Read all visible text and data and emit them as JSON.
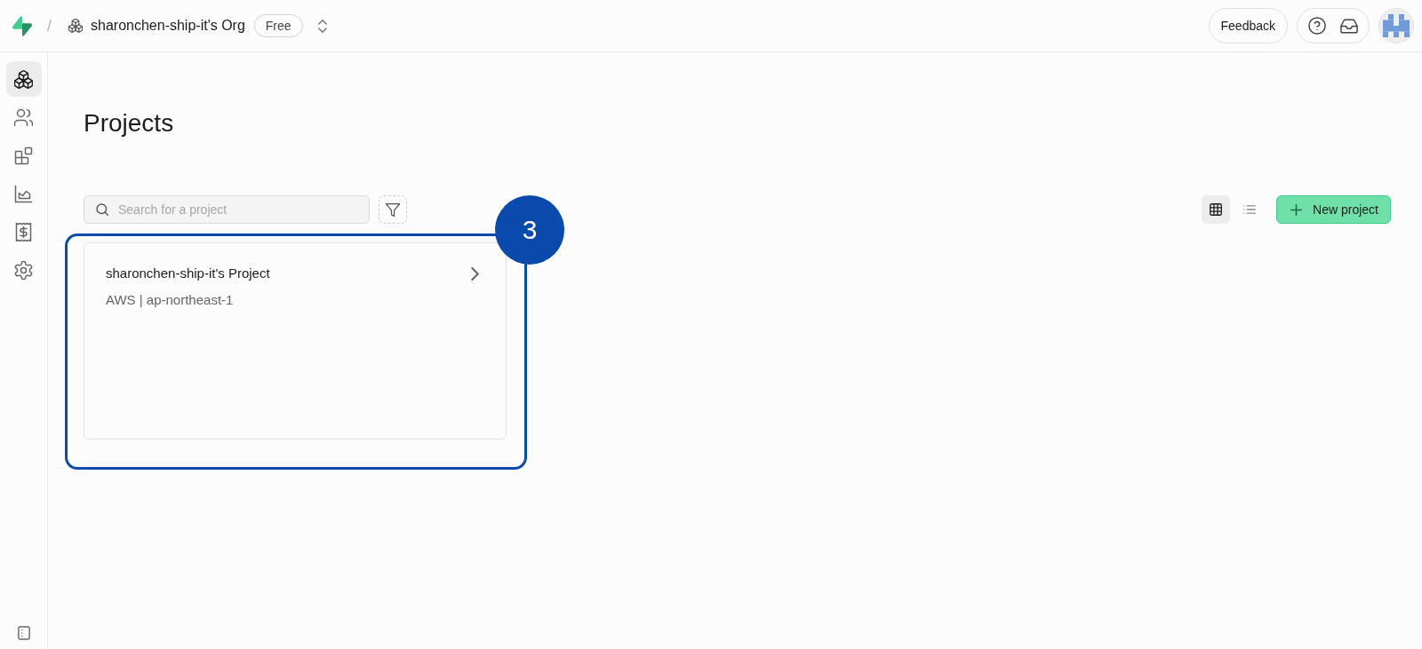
{
  "header": {
    "separator": "/",
    "org_name": "sharonchen-ship-it's Org",
    "plan_badge": "Free",
    "feedback_button": "Feedback"
  },
  "sidebar": {
    "items": [
      {
        "selected": true
      },
      {
        "selected": false
      },
      {
        "selected": false
      },
      {
        "selected": false
      },
      {
        "selected": false
      },
      {
        "selected": false
      }
    ]
  },
  "page": {
    "title": "Projects",
    "search": {
      "placeholder": "Search for a project"
    },
    "view_modes": [
      {
        "selected": true
      },
      {
        "selected": false
      }
    ],
    "new_project_button": "New project"
  },
  "projects": [
    {
      "name": "sharonchen-ship-it's Project",
      "region": "AWS | ap-northeast-1"
    }
  ],
  "callout": {
    "number": "3"
  }
}
